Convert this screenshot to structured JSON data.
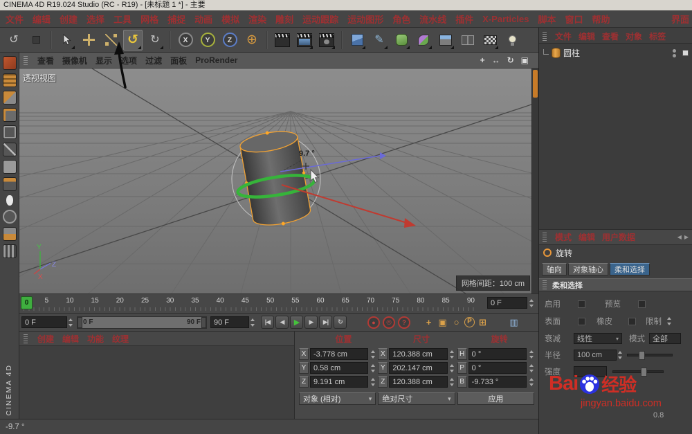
{
  "title_bar": {
    "title": "CINEMA 4D R19.024 Studio (RC - R19) - [未标题 1 *] - 主要"
  },
  "menu_bar": {
    "items": [
      "文件",
      "编辑",
      "创建",
      "选择",
      "工具",
      "网格",
      "捕捉",
      "动画",
      "模拟",
      "渲染",
      "雕刻",
      "运动跟踪",
      "运动图形",
      "角色",
      "流水线",
      "插件",
      "X-Particles",
      "脚本",
      "窗口",
      "帮助"
    ],
    "right_item": "界面"
  },
  "toolbar": {
    "axis_buttons": [
      "X",
      "Y",
      "Z"
    ]
  },
  "icons": {
    "undo": "↺",
    "rotate": "↺",
    "last_tool": "↻",
    "coord_globe": "⊕",
    "pen": "✎",
    "pan": "+",
    "zoom": "↔",
    "orbit": "↻",
    "maximize": "▣",
    "goto_start": "|◀",
    "prev_frame": "◀",
    "play": "▶",
    "next_frame": "▶",
    "goto_end": "▶|",
    "loop": "↻",
    "record": "●",
    "autokey": "◎",
    "help": "?",
    "move_small": "+",
    "window_small": "▣",
    "circle_small": "○",
    "p_badge": "P",
    "grid_small": "⊞",
    "layout": "▥",
    "dropdown": "▾",
    "arrow_left": "◀",
    "arrow_right": "▶"
  },
  "viewport": {
    "menu_items": [
      "查看",
      "摄像机",
      "显示",
      "选项",
      "过滤",
      "面板"
    ],
    "prorender_label": "ProRender",
    "view_label": "透视视图",
    "angle_label": "9.7 °",
    "grid_spacing_label": "网格间距：100 cm",
    "axis_labels": {
      "x": "X",
      "y": "Y",
      "z": "Z"
    }
  },
  "object_manager": {
    "menu_items": [
      "文件",
      "编辑",
      "查看",
      "对象",
      "标签"
    ],
    "objects": [
      {
        "name": "圆柱"
      }
    ]
  },
  "attribute_manager": {
    "tabs": [
      "模式",
      "编辑",
      "用户数据"
    ],
    "tool_label": "旋转",
    "option_tabs": [
      "轴向",
      "对象轴心",
      "柔和选择"
    ],
    "section_title": "柔和选择",
    "fields": {
      "enable_label": "启用",
      "preview_label": "预览",
      "surface_label": "表面",
      "eraser_label": "橡皮",
      "limit_label": "限制",
      "falloff_label": "衰减",
      "falloff_value": "线性",
      "mode_label": "模式",
      "mode_value": "全部",
      "radius_label": "半径",
      "radius_value": "100 cm",
      "strength_label": "强度",
      "partial_value": "0.8"
    }
  },
  "timeline": {
    "ticks": [
      "0",
      "5",
      "10",
      "15",
      "20",
      "25",
      "30",
      "35",
      "40",
      "45",
      "50",
      "55",
      "60",
      "65",
      "70",
      "75",
      "80",
      "85",
      "90"
    ],
    "playhead_label": "0",
    "frame_field": "0 F"
  },
  "transport": {
    "current_frame": "0 F",
    "range_start": "0 F",
    "range_end": "90 F",
    "end_frame": "90 F"
  },
  "material_manager": {
    "menu_items": [
      "创建",
      "编辑",
      "功能",
      "纹理"
    ]
  },
  "coordinates": {
    "headers": [
      "位置",
      "尺寸",
      "旋转"
    ],
    "position": {
      "x_label": "X",
      "x": "-3.778 cm",
      "y_label": "Y",
      "y": "0.58 cm",
      "z_label": "Z",
      "z": "9.191 cm"
    },
    "size": {
      "x_label": "X",
      "x": "120.388 cm",
      "y_label": "Y",
      "y": "202.147 cm",
      "z_label": "Z",
      "z": "120.388 cm"
    },
    "rotation": {
      "h_label": "H",
      "h": "0 °",
      "p_label": "P",
      "p": "0 °",
      "b_label": "B",
      "b": "-9.733 °"
    },
    "mode_object": "对象 (相对)",
    "mode_size": "绝对尺寸",
    "apply_label": "应用"
  },
  "status_bar": {
    "text": "-9.7 °"
  },
  "watermark": {
    "brand_prefix": "Bai",
    "brand_suffix": "经验",
    "url": "jingyan.baidu.com"
  },
  "side_label": "CINEMA 4D"
}
